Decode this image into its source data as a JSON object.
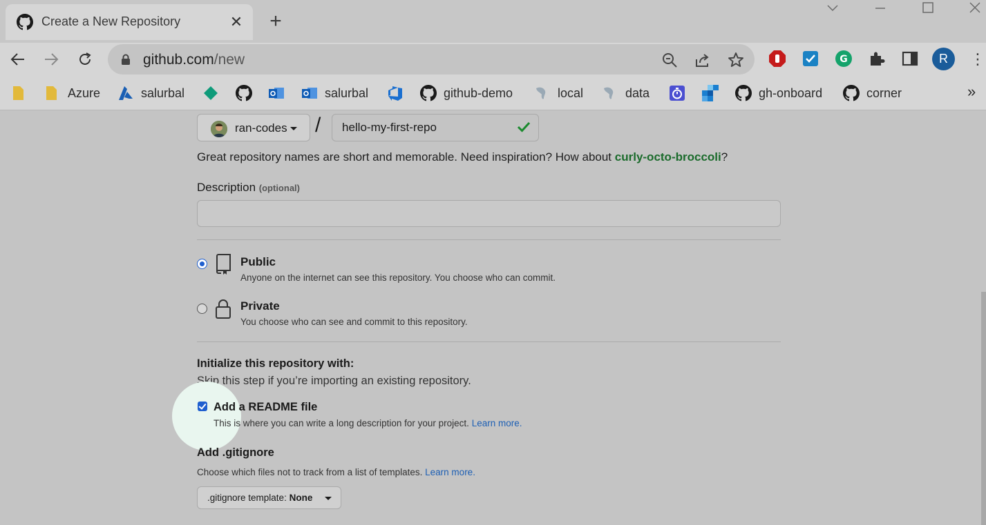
{
  "browser": {
    "tab": {
      "title": "Create a New Repository",
      "favicon": "github-icon"
    },
    "new_tab_label": "+",
    "address": {
      "host": "github.com",
      "path": "/new"
    },
    "profile_initial": "R",
    "bookmarks": [
      {
        "label": "",
        "icon": "folder-icon",
        "color": "#e2b93b"
      },
      {
        "label": "Azure",
        "icon": "folder-icon",
        "color": "#e2b93b"
      },
      {
        "label": "salurbal",
        "icon": "azure-icon",
        "color": "#1a5fb4"
      },
      {
        "label": "",
        "icon": "diamond-icon",
        "color": "#0f9b7a"
      },
      {
        "label": "",
        "icon": "github-icon",
        "color": "#1a1a1a"
      },
      {
        "label": "",
        "icon": "outlook-icon",
        "color": "#0f5bb5"
      },
      {
        "label": "salurbal",
        "icon": "outlook-icon",
        "color": "#0f5bb5"
      },
      {
        "label": "",
        "icon": "azure-devops-icon",
        "color": "#1a6fd0"
      },
      {
        "label": "github-demo",
        "icon": "github-icon",
        "color": "#1a1a1a"
      },
      {
        "label": "local",
        "icon": "map-icon",
        "color": "#9aa9b5"
      },
      {
        "label": "data",
        "icon": "map-icon",
        "color": "#9aa9b5"
      },
      {
        "label": "",
        "icon": "timer-icon",
        "color": "#4b4fd1"
      },
      {
        "label": "",
        "icon": "squares-icon",
        "color": "#1a7fd0"
      },
      {
        "label": "gh-onboard",
        "icon": "github-icon",
        "color": "#1a1a1a"
      },
      {
        "label": "corner",
        "icon": "github-icon",
        "color": "#1a1a1a"
      }
    ],
    "bookmarks_more": "»"
  },
  "form": {
    "owner": "ran-codes",
    "slash": "/",
    "repo_name": "hello-my-first-repo",
    "name_hint_prefix": "Great repository names are short and memorable. Need inspiration? How about ",
    "name_suggestion": "curly-octo-broccoli",
    "name_hint_suffix": "?",
    "description_label": "Description",
    "description_optional": "(optional)",
    "description_value": "",
    "visibility": [
      {
        "title": "Public",
        "sub": "Anyone on the internet can see this repository. You choose who can commit.",
        "selected": true
      },
      {
        "title": "Private",
        "sub": "You choose who can see and commit to this repository.",
        "selected": false
      }
    ],
    "init_title": "Initialize this repository with:",
    "init_sub": "Skip this step if you’re importing an existing repository.",
    "readme": {
      "checked": true,
      "title": "Add a README file",
      "sub": "This is where you can write a long description for your project.",
      "learn_more": "Learn more."
    },
    "gitignore": {
      "title": "Add .gitignore",
      "sub": "Choose which files not to track from a list of templates.",
      "learn_more": "Learn more.",
      "button_prefix": ".gitignore template:",
      "button_value": "None"
    }
  },
  "colors": {
    "accent": "#1f5fcf",
    "success": "#1a6b2b",
    "link": "#1d5fb4"
  }
}
